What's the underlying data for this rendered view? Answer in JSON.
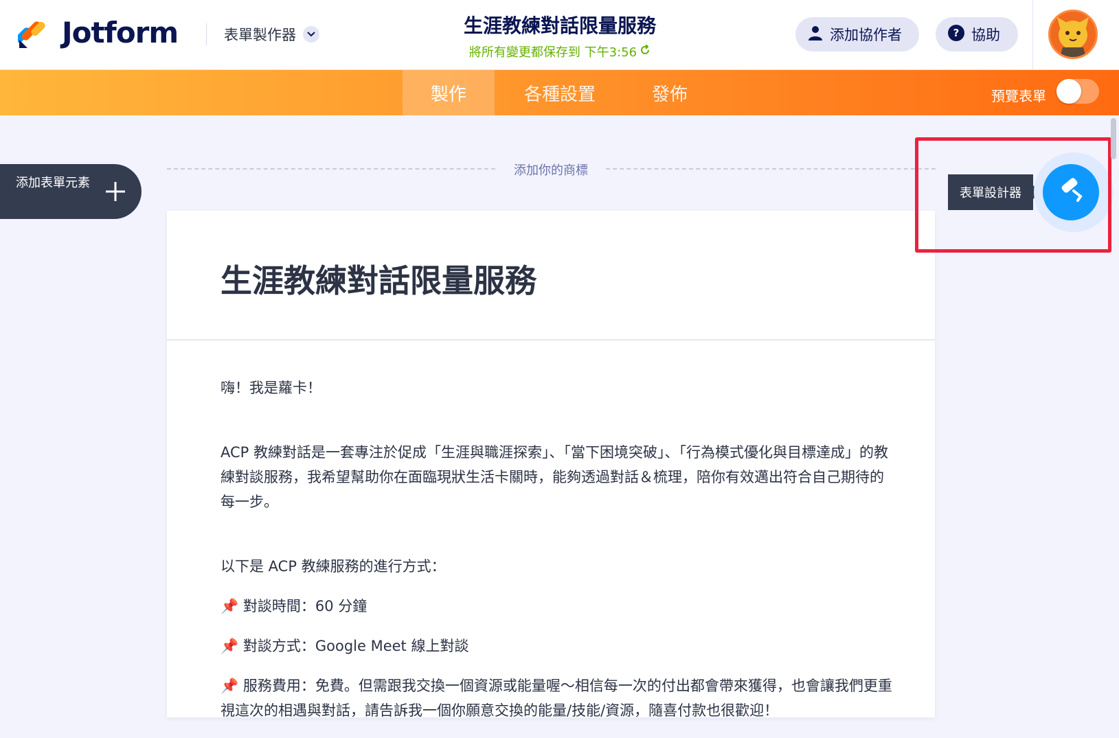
{
  "header": {
    "brand": "Jotform",
    "builder_menu": "表單製作器",
    "form_title": "生涯教練對話限量服務",
    "save_status": "將所有變更都保存到 下午3:56",
    "collaborator_button": "添加協作者",
    "help_button": "協助"
  },
  "nav": {
    "tabs": [
      "製作",
      "各種設置",
      "發佈"
    ],
    "active_tab": "製作",
    "preview_label": "預覽表單",
    "preview_enabled": false
  },
  "canvas": {
    "add_element_label": "添加表單元素",
    "add_logo_label": "添加你的商標",
    "designer_tooltip": "表單設計器"
  },
  "form": {
    "heading": "生涯教練對話限量服務",
    "greeting": "嗨！我是蘿卡！",
    "intro": "ACP 教練對話是一套專注於促成「生涯與職涯探索」、「當下困境突破」、「行為模式優化與目標達成」的教練對談服務，我希望幫助你在面臨現狀生活卡關時，能夠透過對話＆梳理，陪你有效邁出符合自己期待的每一步。",
    "method_intro": "以下是 ACP 教練服務的進行方式：",
    "items": [
      "對談時間：60 分鐘",
      "對談方式：Google Meet 線上對談",
      "服務費用：免費。但需跟我交換一個資源或能量喔～相信每一次的付出都會帶來獲得，也會讓我們更重視這次的相遇與對話，請告訴我一個你願意交換的能量/技能/資源，隨喜付款也很歡迎！"
    ]
  },
  "colors": {
    "brand_orange": "#ff7f1f",
    "save_green": "#64b200",
    "designer_blue": "#0f99ff",
    "highlight_red": "#e8233f"
  }
}
